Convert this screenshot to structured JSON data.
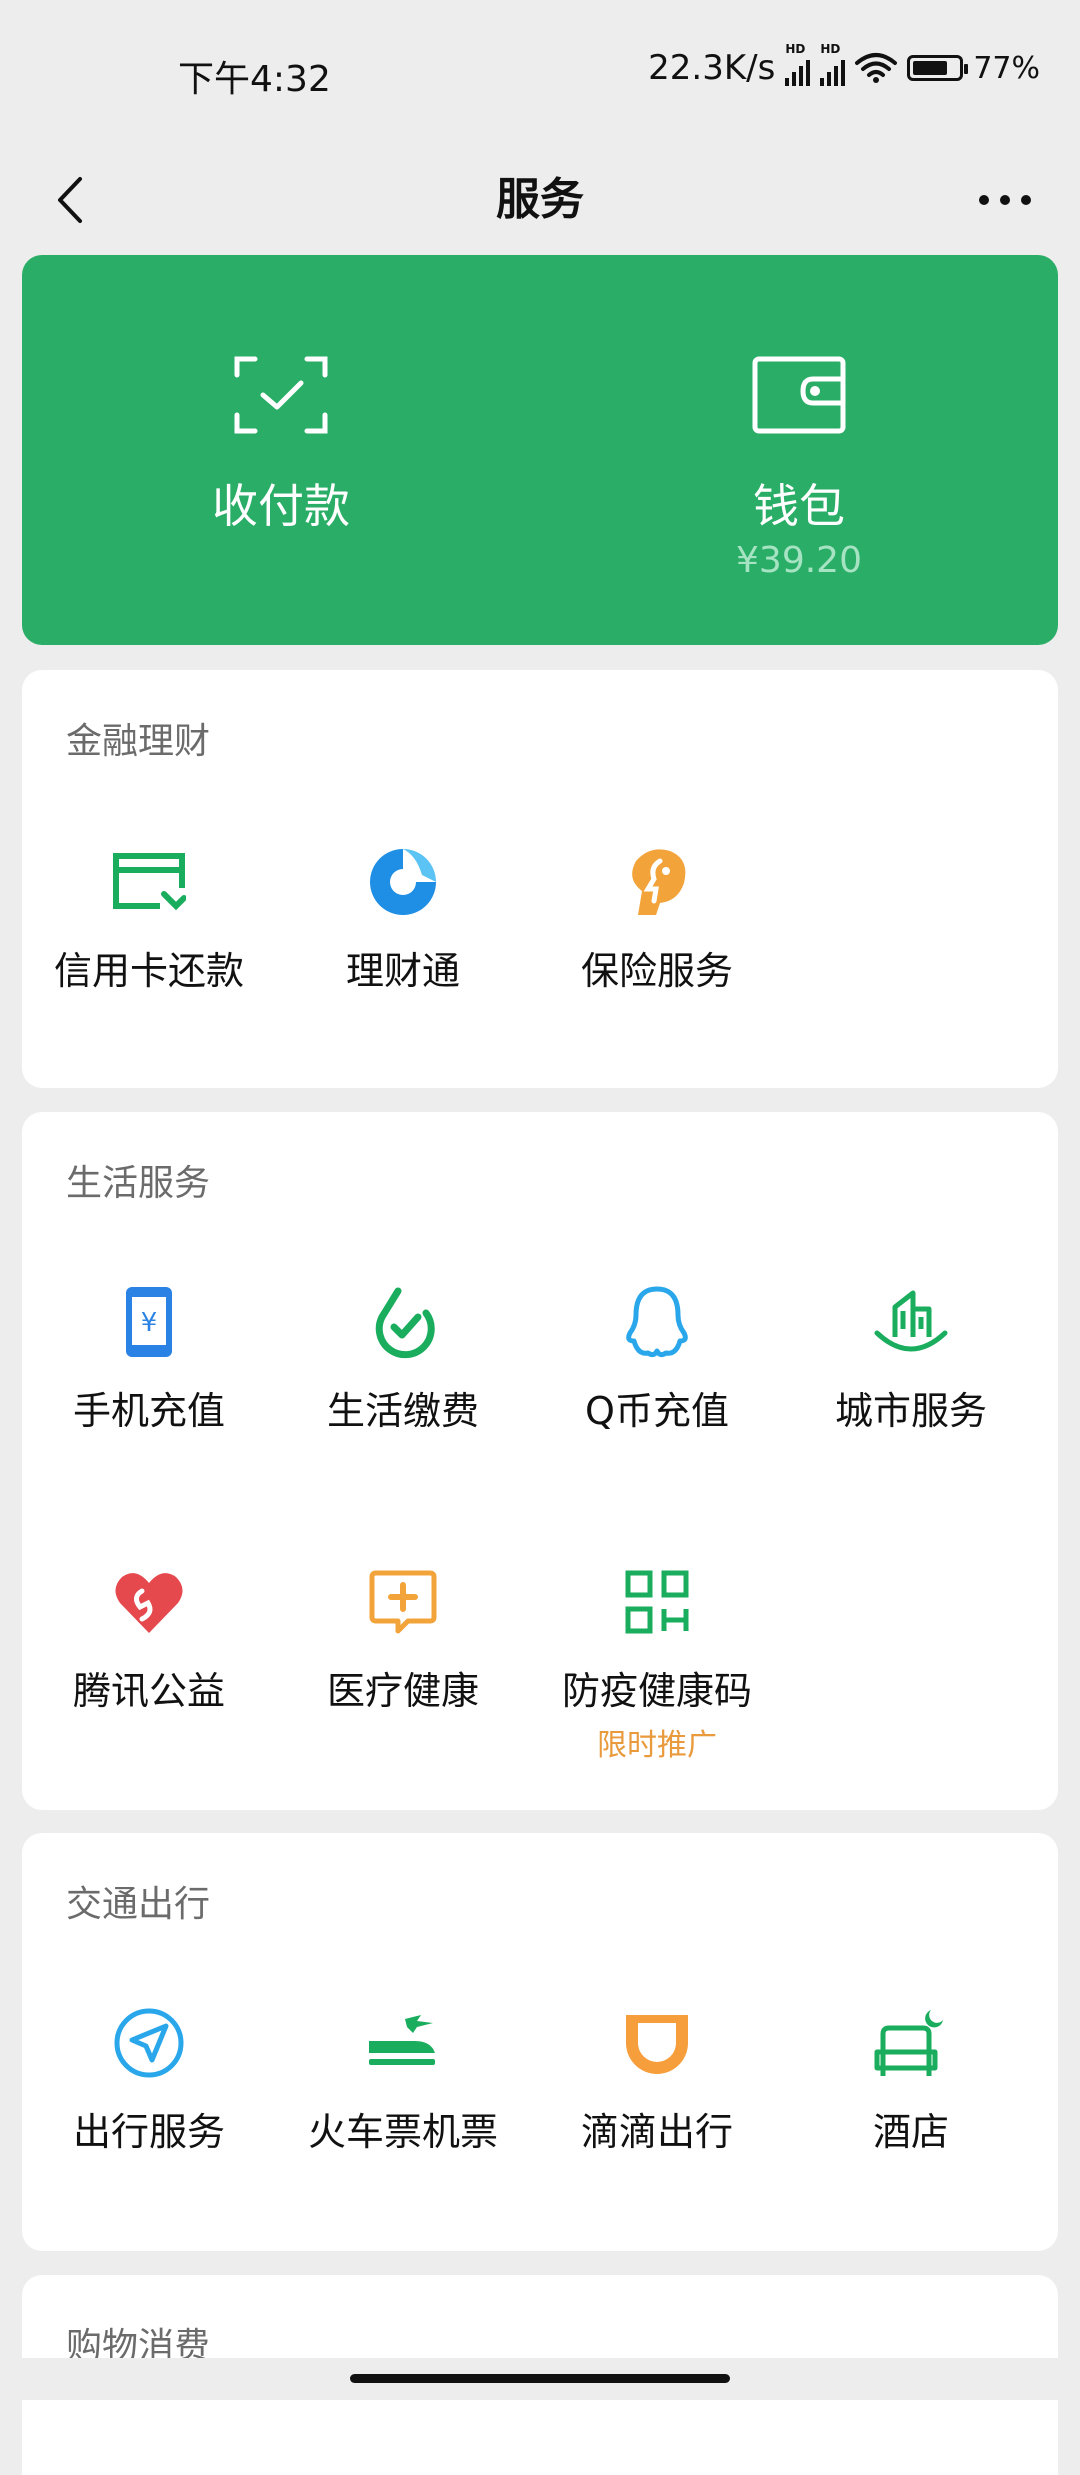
{
  "status_bar": {
    "time": "下午4:32",
    "net_speed": "22.3K/s",
    "battery": "77%",
    "battery_level": 0.77
  },
  "nav": {
    "title": "服务"
  },
  "pay_card": {
    "color": "#2aae67",
    "pay": {
      "label": "收付款",
      "icon": "scan-check-icon"
    },
    "wallet": {
      "label": "钱包",
      "balance": "¥39.20",
      "icon": "wallet-icon"
    }
  },
  "sections": {
    "finance": {
      "title": "金融理财",
      "items": [
        {
          "label": "信用卡还款",
          "icon": "credit-card-icon"
        },
        {
          "label": "理财通",
          "icon": "licaitong-icon"
        },
        {
          "label": "保险服务",
          "icon": "insurance-icon"
        }
      ]
    },
    "life": {
      "title": "生活服务",
      "items": [
        {
          "label": "手机充值",
          "icon": "phone-topup-icon"
        },
        {
          "label": "生活缴费",
          "icon": "utility-payment-icon"
        },
        {
          "label": "Q币充值",
          "icon": "qq-coin-icon"
        },
        {
          "label": "城市服务",
          "icon": "city-service-icon"
        },
        {
          "label": "腾讯公益",
          "icon": "tencent-charity-icon"
        },
        {
          "label": "医疗健康",
          "icon": "medical-health-icon"
        },
        {
          "label": "防疫健康码",
          "icon": "health-code-icon",
          "promo": "限时推广"
        }
      ]
    },
    "travel": {
      "title": "交通出行",
      "items": [
        {
          "label": "出行服务",
          "icon": "travel-service-icon"
        },
        {
          "label": "火车票机票",
          "icon": "train-plane-icon"
        },
        {
          "label": "滴滴出行",
          "icon": "didi-icon"
        },
        {
          "label": "酒店",
          "icon": "hotel-icon"
        }
      ]
    },
    "shopping": {
      "title": "购物消费"
    }
  }
}
